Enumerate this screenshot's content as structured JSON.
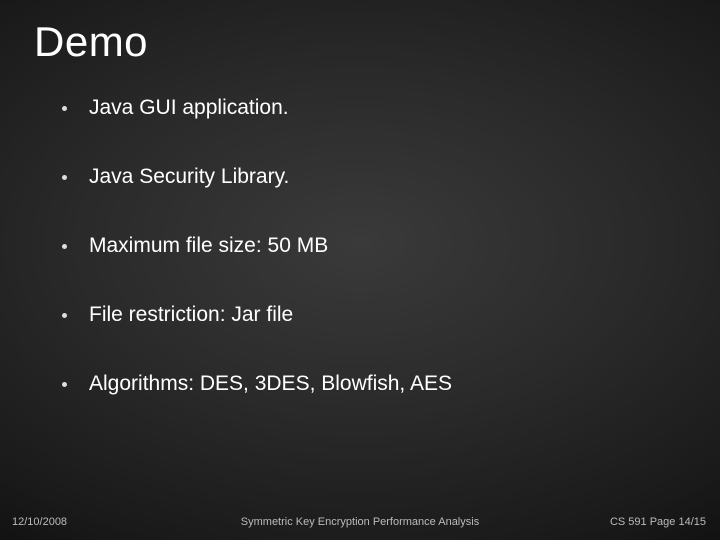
{
  "title": "Demo",
  "bullets": [
    "Java GUI application.",
    "Java Security Library.",
    "Maximum file size: 50 MB",
    "File restriction: Jar file",
    "Algorithms: DES, 3DES, Blowfish, AES"
  ],
  "footer": {
    "date": "12/10/2008",
    "center": "Symmetric Key Encryption Performance Analysis",
    "right": "CS 591 Page 14/15"
  }
}
